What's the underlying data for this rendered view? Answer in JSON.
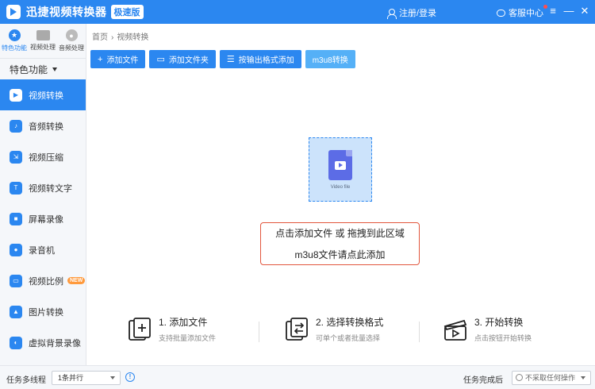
{
  "titlebar": {
    "app_title": "迅捷视频转换器",
    "badge": "极速版",
    "login": "注册/登录",
    "service": "客服中心",
    "menu_icon": "≡",
    "min_icon": "—",
    "close_icon": "✕"
  },
  "sidebar": {
    "top_tabs": [
      {
        "label": "特色功能",
        "icon": "star-icon"
      },
      {
        "label": "视频处理",
        "icon": "film-icon"
      },
      {
        "label": "音频处理",
        "icon": "disc-icon"
      }
    ],
    "special_label": "特色功能",
    "items": [
      {
        "label": "视频转换",
        "icon": "video-convert-icon"
      },
      {
        "label": "音频转换",
        "icon": "audio-convert-icon"
      },
      {
        "label": "视频压缩",
        "icon": "compress-icon"
      },
      {
        "label": "视频转文字",
        "icon": "text-icon"
      },
      {
        "label": "屏幕录像",
        "icon": "screen-record-icon"
      },
      {
        "label": "录音机",
        "icon": "recorder-icon"
      },
      {
        "label": "视频比例",
        "icon": "ratio-icon",
        "badge": "NEW"
      },
      {
        "label": "图片转换",
        "icon": "image-convert-icon"
      },
      {
        "label": "虚拟背景录像",
        "icon": "virtual-bg-icon"
      }
    ]
  },
  "breadcrumb": {
    "home": "首页",
    "current": "视频转换"
  },
  "toolbar": {
    "add_file": "添加文件",
    "add_folder": "添加文件夹",
    "by_format": "按输出格式添加",
    "m3u8": "m3u8转换"
  },
  "dropzone": {
    "caption": "Video file"
  },
  "hint": {
    "line1": "点击添加文件 或 拖拽到此区域",
    "line2": "m3u8文件请点此添加"
  },
  "steps": [
    {
      "title": "1. 添加文件",
      "sub": "支持批量添加文件"
    },
    {
      "title": "2. 选择转换格式",
      "sub": "可单个或者批量选择"
    },
    {
      "title": "3. 开始转换",
      "sub": "点击按钮开始转换"
    }
  ],
  "footer": {
    "thread_label": "任务多线程",
    "thread_value": "1条并行",
    "done_label": "任务完成后",
    "done_value": "不采取任何操作"
  },
  "colors": {
    "accent": "#2b87f0",
    "hint_border": "#e2563d"
  }
}
